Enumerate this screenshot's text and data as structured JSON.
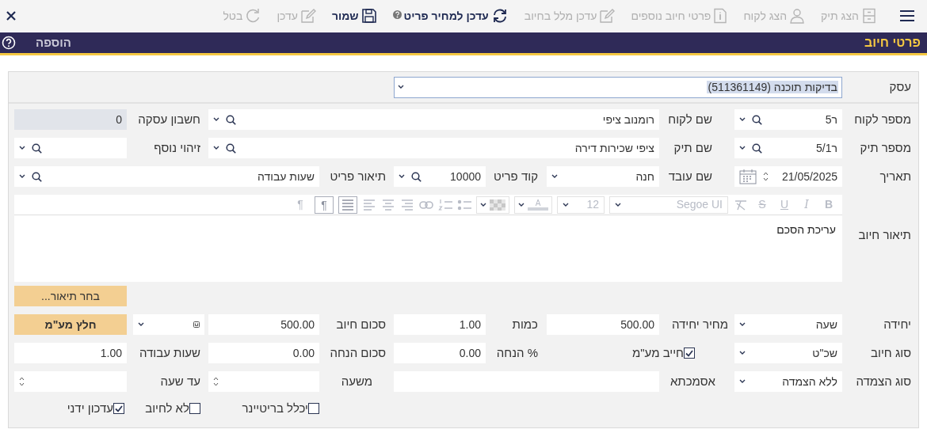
{
  "toolbar": {
    "items": [
      {
        "kind": "show_file",
        "label": "הצג תיק",
        "disabled": true
      },
      {
        "kind": "show_customer",
        "label": "הצג לקוח",
        "disabled": true
      },
      {
        "kind": "extra_details",
        "label": "פרטי חיוב נוספים",
        "disabled": true
      },
      {
        "kind": "edit_text",
        "label": "עדכן מלל בחיוב",
        "disabled": true
      },
      {
        "kind": "refresh_price",
        "label": "עדכן למחיר פריט",
        "disabled": false
      },
      {
        "kind": "save",
        "label": "שמור",
        "disabled": false
      },
      {
        "kind": "edit",
        "label": "עדכן",
        "disabled": true
      },
      {
        "kind": "cancel",
        "label": "בטל",
        "disabled": true
      }
    ]
  },
  "header": {
    "title": "פרטי חיוב",
    "mode": "הוספה"
  },
  "business": {
    "label": "עסק",
    "value": "בדיקות תוכנה (511361149)"
  },
  "fields": {
    "customer_number": {
      "label": "מספר לקוח",
      "value": "ר5"
    },
    "customer_name": {
      "label": "שם לקוח",
      "value": "רומנוב ציפי"
    },
    "deal_account": {
      "label": "חשבון עסקה",
      "value": "0"
    },
    "file_number": {
      "label": "מספר תיק",
      "value": "ר5/1"
    },
    "file_name": {
      "label": "שם תיק",
      "value": "ציפי שכירות דירה"
    },
    "extra_id": {
      "label": "זיהוי נוסף"
    },
    "date": {
      "label": "תאריך",
      "value": "21/05/2025"
    },
    "employee": {
      "label": "שם עובד",
      "value": "חנה"
    },
    "item_code": {
      "label": "קוד פריט",
      "value": "10000"
    },
    "item_description": {
      "label": "תיאור פריט",
      "value": "שעות עבודה"
    },
    "charge_description": {
      "label": "תיאור חיוב",
      "value": "עריכת הסכם"
    },
    "choose_description": {
      "label": "בחר תיאור..."
    },
    "unit": {
      "label": "יחידה",
      "value": "שעה"
    },
    "unit_price": {
      "label": "מחיר יחידה",
      "value": "500.00"
    },
    "quantity": {
      "label": "כמות",
      "value": "1.00"
    },
    "charge_amount": {
      "label": "סכום חיוב",
      "value": "500.00"
    },
    "extract_vat": {
      "label": "חלץ מע\"מ"
    },
    "charge_type": {
      "label": "סוג חיוב",
      "value": "שכ\"ט"
    },
    "vat_required": {
      "label": "חייב מע\"מ",
      "checked": true
    },
    "discount_percent": {
      "label": "% הנחה",
      "value": "0.00"
    },
    "discount_amount": {
      "label": "סכום הנחה",
      "value": "0.00"
    },
    "work_hours": {
      "label": "שעות עבודה",
      "value": "1.00"
    },
    "linkage_type": {
      "label": "סוג הצמדה",
      "value": "ללא הצמדה"
    },
    "reference": {
      "label": "אסמכתא"
    },
    "from_hour": {
      "label": "משעה"
    },
    "to_hour": {
      "label": "עד שעה"
    },
    "include_retainer": {
      "label": "יכלל בריטיינר",
      "checked": false
    },
    "no_charge": {
      "label": "לא לחיוב",
      "checked": false
    },
    "manual_update": {
      "label": "עדכון ידני",
      "checked": true
    }
  },
  "editor_toolbar": {
    "buttons": [
      {
        "kind": "bold",
        "glyph": "B"
      },
      {
        "kind": "italic",
        "glyph": "I"
      },
      {
        "kind": "underline",
        "glyph": "U"
      },
      {
        "kind": "strike",
        "glyph": "S"
      }
    ],
    "font": "Segoe UI",
    "size": "12",
    "color_glyph": "A",
    "ltr_glyph": "¶",
    "rtl_glyph": "¶"
  }
}
